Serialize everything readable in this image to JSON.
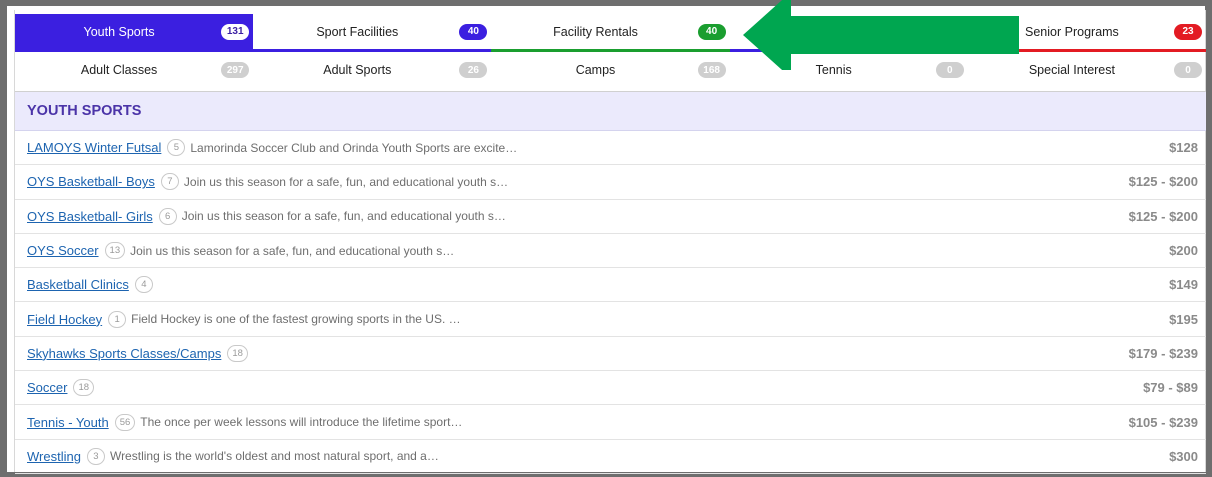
{
  "tabs_row1": [
    {
      "label": "Youth Sports",
      "count": "131",
      "color": "#3b1fe0",
      "active": true
    },
    {
      "label": "Sport Facilities",
      "count": "40",
      "color": "#3b1fe0",
      "active": false
    },
    {
      "label": "Facility Rentals",
      "count": "40",
      "color": "#1a9e2f",
      "active": false
    },
    {
      "label": "",
      "count": "",
      "color": "#3b1fe0",
      "active": false
    },
    {
      "label": "Senior Programs",
      "count": "23",
      "color": "#e31b23",
      "active": false
    }
  ],
  "tabs_row2": [
    {
      "label": "Adult Classes",
      "count": "297"
    },
    {
      "label": "Adult Sports",
      "count": "26"
    },
    {
      "label": "Camps",
      "count": "168"
    },
    {
      "label": "Tennis",
      "count": "0"
    },
    {
      "label": "Special Interest",
      "count": "0"
    }
  ],
  "section": {
    "title": "YOUTH SPORTS"
  },
  "programs": [
    {
      "name": "LAMOYS Winter Futsal",
      "count": "5",
      "desc": "Lamorinda Soccer Club and Orinda Youth Sports are excite…",
      "price": "$128"
    },
    {
      "name": "OYS Basketball- Boys",
      "count": "7",
      "desc": "Join us this season for a safe, fun, and educational youth s…",
      "price": "$125 - $200"
    },
    {
      "name": "OYS Basketball- Girls",
      "count": "6",
      "desc": "Join us this season for a safe, fun, and educational youth s…",
      "price": "$125 - $200"
    },
    {
      "name": "OYS Soccer",
      "count": "13",
      "desc": "Join us this season for a safe, fun, and educational youth s…",
      "price": "$200"
    },
    {
      "name": "Basketball Clinics",
      "count": "4",
      "desc": "",
      "price": "$149"
    },
    {
      "name": "Field Hockey",
      "count": "1",
      "desc": "Field Hockey is one of the fastest growing sports in the US. …",
      "price": "$195"
    },
    {
      "name": "Skyhawks Sports Classes/Camps",
      "count": "18",
      "desc": "",
      "price": "$179 - $239"
    },
    {
      "name": "Soccer",
      "count": "18",
      "desc": "",
      "price": "$79 - $89"
    },
    {
      "name": "Tennis - Youth",
      "count": "56",
      "desc": "The once per week lessons will introduce the lifetime sport…",
      "price": "$105 - $239"
    },
    {
      "name": "Wrestling",
      "count": "3",
      "desc": "Wrestling is the world's oldest and most natural sport, and a…",
      "price": "$300"
    }
  ],
  "colors": {
    "accent": "#3b1fe0",
    "green": "#1a9e2f",
    "red": "#e31b23",
    "arrow": "#00a650"
  },
  "overlay": {
    "icon": "left-arrow-icon"
  }
}
